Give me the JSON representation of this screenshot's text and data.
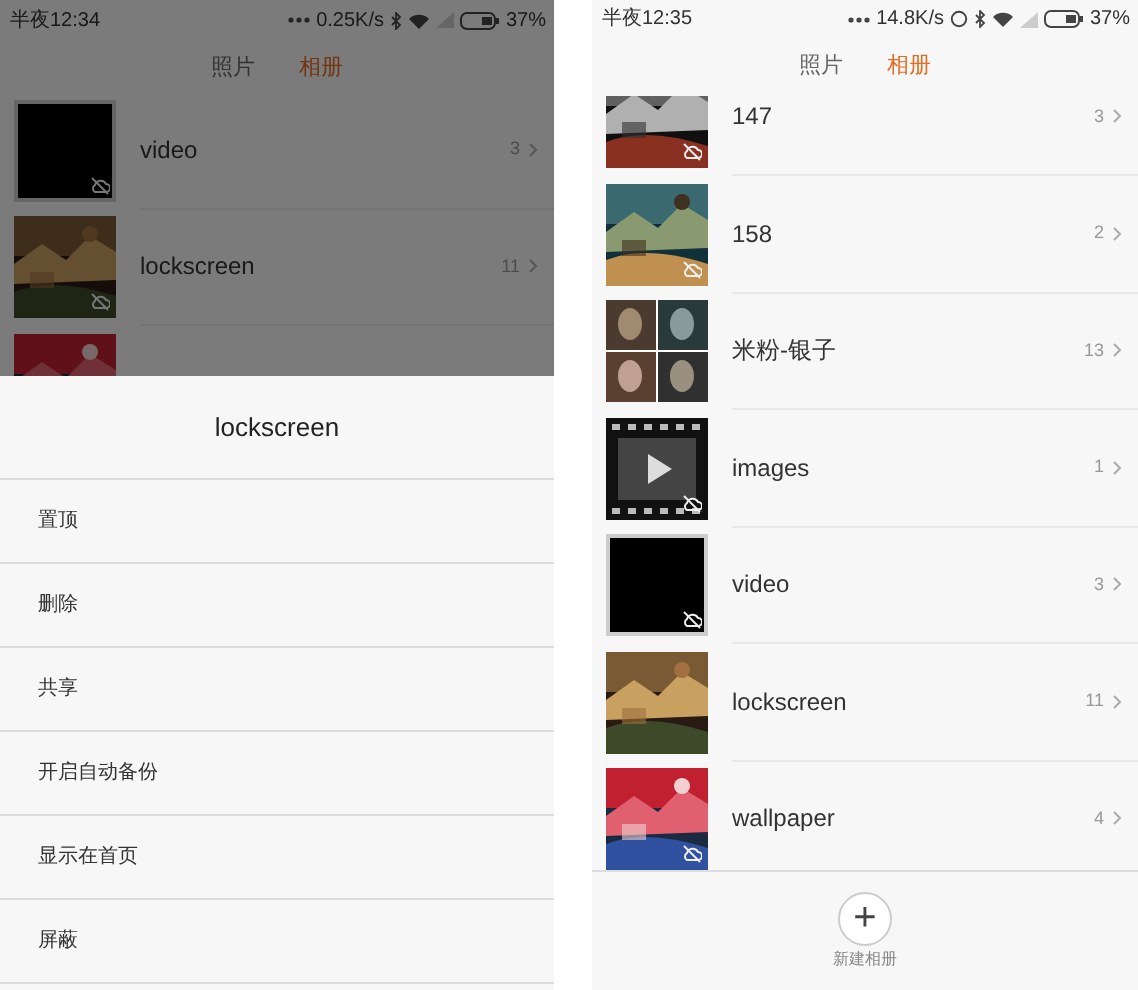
{
  "screens": [
    {
      "status_bar": {
        "time": "半夜12:34",
        "speed": "0.25K/s",
        "sync": false,
        "battery": "37%"
      },
      "tabs": [
        {
          "label": "照片",
          "selected": false
        },
        {
          "label": "相册",
          "selected": true
        }
      ],
      "dimmed": true,
      "albums": [
        {
          "kind": "blank",
          "name": "video",
          "count": "3",
          "cloud_badge": true
        },
        {
          "kind": "picture",
          "name": "lockscreen",
          "count": "11",
          "cloud_badge": true
        },
        {
          "kind": "picture",
          "cloud_badge": false
        }
      ],
      "sheet": {
        "title": "lockscreen",
        "options": [
          "置顶",
          "删除",
          "共享",
          "开启自动备份",
          "显示在首页",
          "屏蔽"
        ]
      }
    },
    {
      "status_bar": {
        "time": "半夜12:35",
        "speed": "14.8K/s",
        "sync": true,
        "battery": "37%"
      },
      "tabs": [
        {
          "label": "照片",
          "selected": false
        },
        {
          "label": "相册",
          "selected": true
        }
      ],
      "dimmed": false,
      "albums": [
        {
          "kind": "picture",
          "name": "147",
          "count": "3",
          "cloud_badge": true
        },
        {
          "kind": "picture",
          "name": "158",
          "count": "2",
          "cloud_badge": true
        },
        {
          "kind": "collage",
          "name": "米粉-银子",
          "count": "13",
          "cloud_badge": false
        },
        {
          "kind": "video",
          "name": "images",
          "count": "1",
          "cloud_badge": true
        },
        {
          "kind": "blank",
          "name": "video",
          "count": "3",
          "cloud_badge": true
        },
        {
          "kind": "picture",
          "name": "lockscreen",
          "count": "11",
          "cloud_badge": false
        },
        {
          "kind": "picture",
          "name": "wallpaper",
          "count": "4",
          "cloud_badge": true
        }
      ],
      "new_album": {
        "icon": "+",
        "label": "新建相册"
      }
    }
  ]
}
